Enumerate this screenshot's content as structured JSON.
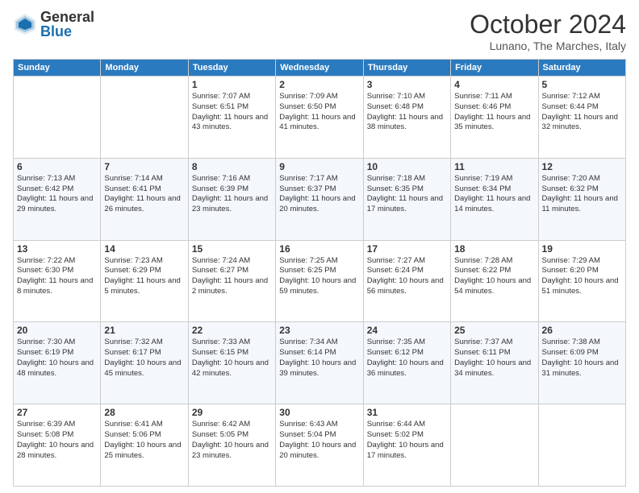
{
  "logo": {
    "general": "General",
    "blue": "Blue"
  },
  "title": "October 2024",
  "location": "Lunano, The Marches, Italy",
  "days_of_week": [
    "Sunday",
    "Monday",
    "Tuesday",
    "Wednesday",
    "Thursday",
    "Friday",
    "Saturday"
  ],
  "weeks": [
    [
      {
        "day": "",
        "info": ""
      },
      {
        "day": "",
        "info": ""
      },
      {
        "day": "1",
        "info": "Sunrise: 7:07 AM\nSunset: 6:51 PM\nDaylight: 11 hours and 43 minutes."
      },
      {
        "day": "2",
        "info": "Sunrise: 7:09 AM\nSunset: 6:50 PM\nDaylight: 11 hours and 41 minutes."
      },
      {
        "day": "3",
        "info": "Sunrise: 7:10 AM\nSunset: 6:48 PM\nDaylight: 11 hours and 38 minutes."
      },
      {
        "day": "4",
        "info": "Sunrise: 7:11 AM\nSunset: 6:46 PM\nDaylight: 11 hours and 35 minutes."
      },
      {
        "day": "5",
        "info": "Sunrise: 7:12 AM\nSunset: 6:44 PM\nDaylight: 11 hours and 32 minutes."
      }
    ],
    [
      {
        "day": "6",
        "info": "Sunrise: 7:13 AM\nSunset: 6:42 PM\nDaylight: 11 hours and 29 minutes."
      },
      {
        "day": "7",
        "info": "Sunrise: 7:14 AM\nSunset: 6:41 PM\nDaylight: 11 hours and 26 minutes."
      },
      {
        "day": "8",
        "info": "Sunrise: 7:16 AM\nSunset: 6:39 PM\nDaylight: 11 hours and 23 minutes."
      },
      {
        "day": "9",
        "info": "Sunrise: 7:17 AM\nSunset: 6:37 PM\nDaylight: 11 hours and 20 minutes."
      },
      {
        "day": "10",
        "info": "Sunrise: 7:18 AM\nSunset: 6:35 PM\nDaylight: 11 hours and 17 minutes."
      },
      {
        "day": "11",
        "info": "Sunrise: 7:19 AM\nSunset: 6:34 PM\nDaylight: 11 hours and 14 minutes."
      },
      {
        "day": "12",
        "info": "Sunrise: 7:20 AM\nSunset: 6:32 PM\nDaylight: 11 hours and 11 minutes."
      }
    ],
    [
      {
        "day": "13",
        "info": "Sunrise: 7:22 AM\nSunset: 6:30 PM\nDaylight: 11 hours and 8 minutes."
      },
      {
        "day": "14",
        "info": "Sunrise: 7:23 AM\nSunset: 6:29 PM\nDaylight: 11 hours and 5 minutes."
      },
      {
        "day": "15",
        "info": "Sunrise: 7:24 AM\nSunset: 6:27 PM\nDaylight: 11 hours and 2 minutes."
      },
      {
        "day": "16",
        "info": "Sunrise: 7:25 AM\nSunset: 6:25 PM\nDaylight: 10 hours and 59 minutes."
      },
      {
        "day": "17",
        "info": "Sunrise: 7:27 AM\nSunset: 6:24 PM\nDaylight: 10 hours and 56 minutes."
      },
      {
        "day": "18",
        "info": "Sunrise: 7:28 AM\nSunset: 6:22 PM\nDaylight: 10 hours and 54 minutes."
      },
      {
        "day": "19",
        "info": "Sunrise: 7:29 AM\nSunset: 6:20 PM\nDaylight: 10 hours and 51 minutes."
      }
    ],
    [
      {
        "day": "20",
        "info": "Sunrise: 7:30 AM\nSunset: 6:19 PM\nDaylight: 10 hours and 48 minutes."
      },
      {
        "day": "21",
        "info": "Sunrise: 7:32 AM\nSunset: 6:17 PM\nDaylight: 10 hours and 45 minutes."
      },
      {
        "day": "22",
        "info": "Sunrise: 7:33 AM\nSunset: 6:15 PM\nDaylight: 10 hours and 42 minutes."
      },
      {
        "day": "23",
        "info": "Sunrise: 7:34 AM\nSunset: 6:14 PM\nDaylight: 10 hours and 39 minutes."
      },
      {
        "day": "24",
        "info": "Sunrise: 7:35 AM\nSunset: 6:12 PM\nDaylight: 10 hours and 36 minutes."
      },
      {
        "day": "25",
        "info": "Sunrise: 7:37 AM\nSunset: 6:11 PM\nDaylight: 10 hours and 34 minutes."
      },
      {
        "day": "26",
        "info": "Sunrise: 7:38 AM\nSunset: 6:09 PM\nDaylight: 10 hours and 31 minutes."
      }
    ],
    [
      {
        "day": "27",
        "info": "Sunrise: 6:39 AM\nSunset: 5:08 PM\nDaylight: 10 hours and 28 minutes."
      },
      {
        "day": "28",
        "info": "Sunrise: 6:41 AM\nSunset: 5:06 PM\nDaylight: 10 hours and 25 minutes."
      },
      {
        "day": "29",
        "info": "Sunrise: 6:42 AM\nSunset: 5:05 PM\nDaylight: 10 hours and 23 minutes."
      },
      {
        "day": "30",
        "info": "Sunrise: 6:43 AM\nSunset: 5:04 PM\nDaylight: 10 hours and 20 minutes."
      },
      {
        "day": "31",
        "info": "Sunrise: 6:44 AM\nSunset: 5:02 PM\nDaylight: 10 hours and 17 minutes."
      },
      {
        "day": "",
        "info": ""
      },
      {
        "day": "",
        "info": ""
      }
    ]
  ]
}
